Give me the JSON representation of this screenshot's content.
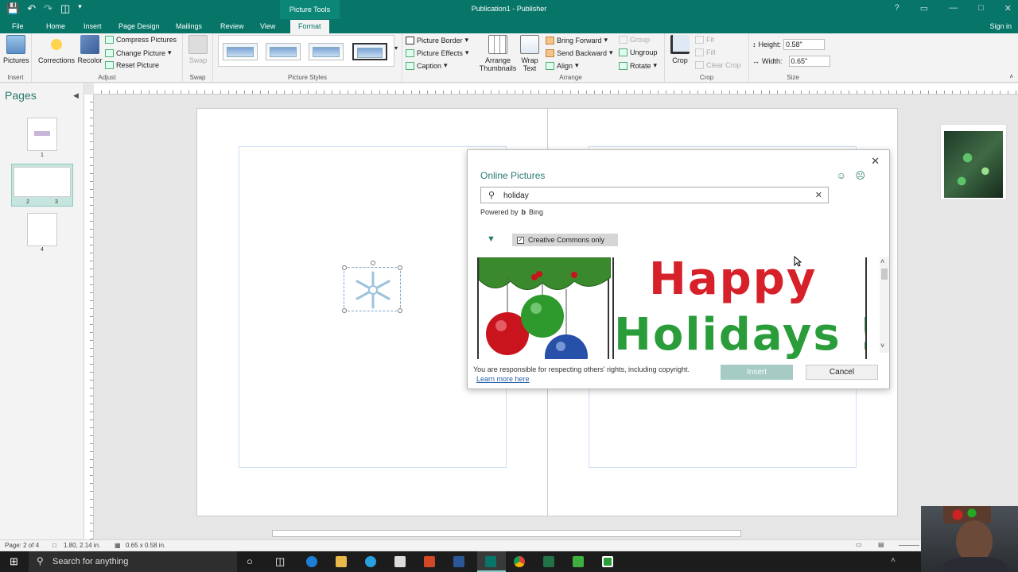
{
  "titlebar": {
    "context_tab": "Picture Tools",
    "title": "Publication1 - Publisher"
  },
  "tabs": [
    "File",
    "Home",
    "Insert",
    "Page Design",
    "Mailings",
    "Review",
    "View",
    "Format"
  ],
  "signin": "Sign in",
  "ribbon": {
    "insert": {
      "pictures": "Pictures",
      "group": "Insert"
    },
    "adjust": {
      "corrections": "Corrections",
      "recolor": "Recolor",
      "compress": "Compress Pictures",
      "change": "Change Picture",
      "reset": "Reset Picture",
      "group": "Adjust"
    },
    "swap": {
      "swap": "Swap",
      "group": "Swap"
    },
    "picture_styles": {
      "group": "Picture Styles"
    },
    "styles_right": {
      "border": "Picture Border",
      "effects": "Picture Effects",
      "caption": "Caption"
    },
    "arrange": {
      "thumbnails": "Arrange Thumbnails",
      "wrap": "Wrap Text",
      "bring_forward": "Bring Forward",
      "send_backward": "Send Backward",
      "align": "Align",
      "group_btn": "Group",
      "ungroup": "Ungroup",
      "rotate": "Rotate",
      "group": "Arrange"
    },
    "crop": {
      "crop": "Crop",
      "fit": "Fit",
      "fill": "Fill",
      "clear": "Clear Crop",
      "group": "Crop"
    },
    "size": {
      "height_label": "Height:",
      "height_value": "0.58\"",
      "width_label": "Width:",
      "width_value": "0.65\"",
      "group": "Size"
    }
  },
  "pages_panel": {
    "title": "Pages",
    "numbers": [
      "1",
      "2",
      "3",
      "4"
    ]
  },
  "dialog": {
    "title": "Online Pictures",
    "search_value": "holiday",
    "powered_by": "Powered by",
    "bing": "Bing",
    "filter_chip": "Creative Commons only",
    "happy_line1": "Happy",
    "happy_line2": "Holidays !",
    "note": "You are responsible for respecting others' rights, including copyright.",
    "learn_more": "Learn more here",
    "insert": "Insert",
    "cancel": "Cancel"
  },
  "statusbar": {
    "page": "Page: 2 of 4",
    "position": "1.80, 2.14 in.",
    "size": "0.65 x 0.58 in."
  },
  "taskbar": {
    "search": "Search for anything"
  },
  "colors": {
    "accent": "#077568",
    "holiday_red": "#d6202a",
    "holiday_green": "#2a9d3a"
  }
}
